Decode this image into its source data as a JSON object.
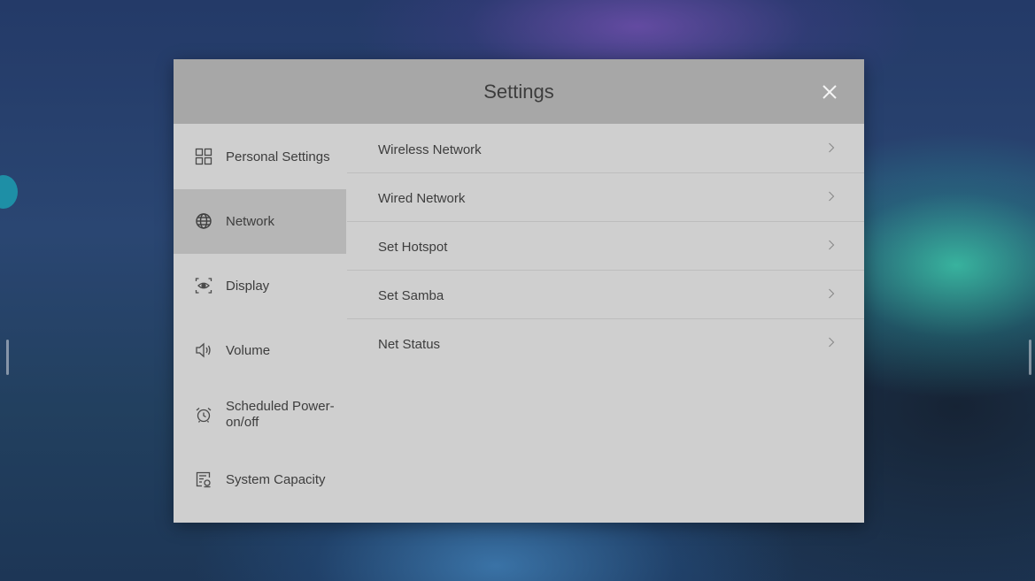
{
  "dialog": {
    "title": "Settings",
    "close_icon": "close-icon"
  },
  "sidebar": {
    "selected": "Network",
    "items": [
      {
        "label": "Personal Settings",
        "icon": "grid-icon"
      },
      {
        "label": "Network",
        "icon": "globe-icon"
      },
      {
        "label": "Display",
        "icon": "eye-icon"
      },
      {
        "label": "Volume",
        "icon": "speaker-icon"
      },
      {
        "label": "Scheduled Power-on/off",
        "icon": "alarm-clock-icon"
      },
      {
        "label": "System Capacity",
        "icon": "storage-icon"
      }
    ]
  },
  "network_menu": {
    "items": [
      {
        "label": "Wireless Network",
        "icon": "chevron-right-icon"
      },
      {
        "label": "Wired Network",
        "icon": "chevron-right-icon"
      },
      {
        "label": "Set Hotspot",
        "icon": "chevron-right-icon"
      },
      {
        "label": "Set Samba",
        "icon": "chevron-right-icon"
      },
      {
        "label": "Net Status",
        "icon": "chevron-right-icon"
      }
    ]
  },
  "colors": {
    "dialog_background": "#cfcfcf",
    "header_background": "#a7a7a7",
    "selected_item_background": "#b6b6b6",
    "text": "#3d3d3d"
  }
}
